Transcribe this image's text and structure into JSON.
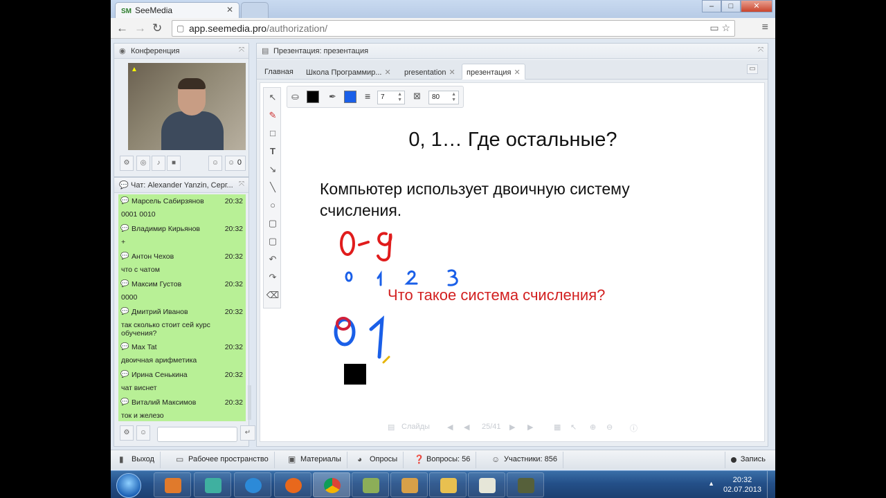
{
  "browser": {
    "tab_title": "SeeMedia",
    "tab_logo": "SM",
    "url_host": "app.seemedia.pro",
    "url_path": "/authorization/",
    "window_controls": [
      "–",
      "□",
      "✕"
    ]
  },
  "conference": {
    "title": "Конференция",
    "participants_count": "0"
  },
  "chat": {
    "title": "Чат: Alexander Yanzin, Серг...",
    "messages": [
      {
        "author": "Марсель Сабирзянов",
        "time": "20:32",
        "text": "0001 0010"
      },
      {
        "author": "Владимир Кирьянов",
        "time": "20:32",
        "text": "+"
      },
      {
        "author": "Антон Чехов",
        "time": "20:32",
        "text": "что с чатом"
      },
      {
        "author": "Максим Густов",
        "time": "20:32",
        "text": "0000"
      },
      {
        "author": "Дмитрий Иванов",
        "time": "20:32",
        "text": "так сколько стоит сей курс обучения?"
      },
      {
        "author": "Max Tat",
        "time": "20:32",
        "text": "двоичная арифметика"
      },
      {
        "author": "Ирина Сенькина",
        "time": "20:32",
        "text": "чат виснет"
      },
      {
        "author": "Виталий Максимов",
        "time": "20:32",
        "text": "ток и железо"
      }
    ],
    "input_placeholder": ""
  },
  "presentation": {
    "title": "Презентация: презентация",
    "tabs": [
      {
        "label": "Главная",
        "closable": false,
        "active": false
      },
      {
        "label": "Школа Программир...",
        "closable": true,
        "active": false
      },
      {
        "label": "presentation",
        "closable": true,
        "active": false
      },
      {
        "label": "презентация",
        "closable": true,
        "active": true
      }
    ],
    "stroke_width": "7",
    "opacity": "80",
    "fill_color": "#000000",
    "stroke_color": "#1a5fe8",
    "slide": {
      "title": "0, 1… Где остальные?",
      "body": "Компьютер использует двоичную систему счисления.",
      "question": "Что такое система счисления?"
    },
    "slides_label": "Слайды",
    "page_indicator": "25/41"
  },
  "bottom_bar": {
    "exit": "Выход",
    "workspace": "Рабочее пространство",
    "materials": "Материалы",
    "polls": "Опросы",
    "questions": "Вопросы: 56",
    "participants": "Участники: 856",
    "record": "Запись"
  },
  "taskbar": {
    "time": "20:32",
    "date": "02.07.2013"
  }
}
